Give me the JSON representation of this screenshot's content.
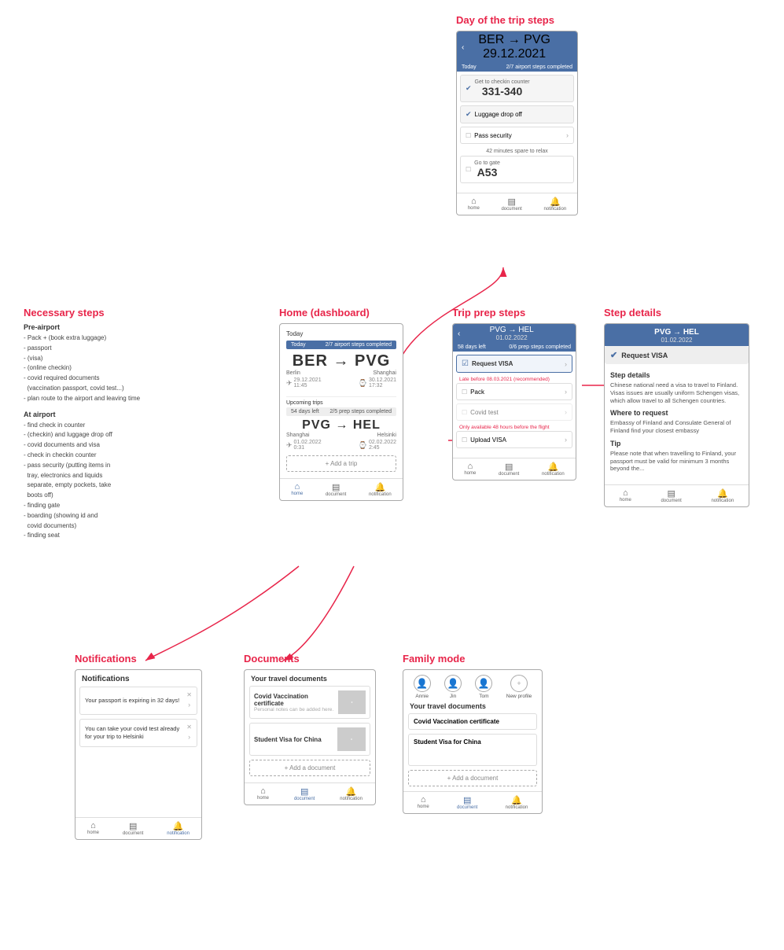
{
  "sections": {
    "day_of_trip": {
      "label": "Day of the trip steps",
      "header": {
        "route": "BER → PVG",
        "date": "29.12.2021"
      },
      "status_bar": {
        "label": "Today",
        "progress": "2/7 airport steps completed"
      },
      "steps": [
        {
          "id": 1,
          "text": "Get to checkin counter",
          "value": "331-340",
          "completed": true,
          "type": "big"
        },
        {
          "id": 2,
          "text": "Luggage drop off",
          "completed": true,
          "type": "normal"
        },
        {
          "id": 3,
          "text": "Pass security",
          "completed": false,
          "type": "normal",
          "has_chevron": true
        },
        {
          "id": 4,
          "relax": "42 minutes spare to relax"
        },
        {
          "id": 5,
          "text": "Go to gate",
          "value": "A53",
          "completed": false,
          "type": "big"
        }
      ],
      "bottom_nav": [
        "home",
        "document",
        "notification"
      ]
    },
    "home_dashboard": {
      "label": "Home (dashboard)",
      "today_label": "Today",
      "today_bar": {
        "left": "Today",
        "right": "2/7 airport steps completed"
      },
      "current_trip": {
        "route": "BER → PVG",
        "from_city": "Berlin",
        "to_city": "Shanghai",
        "from_date": "29.12.2021\n11:45",
        "to_date": "30.12.2021\n17:32"
      },
      "upcoming_label": "Upcoming trips",
      "upcoming_bar": {
        "left": "54 days left",
        "right": "2/5 prep steps completed"
      },
      "upcoming_trip": {
        "route": "PVG → HEL",
        "from_city": "Shanghai",
        "to_city": "Helsinki",
        "from_date": "01.02.2022\n0:31",
        "to_date": "02.02.2022\n2:45"
      },
      "add_trip": "+ Add a trip",
      "bottom_nav": [
        "home",
        "document",
        "notification"
      ]
    },
    "trip_prep": {
      "label": "Trip prep steps",
      "header": {
        "route": "PVG → HEL",
        "date": "01.02.2022"
      },
      "status_bar": {
        "left": "58 days left",
        "right": "0/6 prep steps completed"
      },
      "steps": [
        {
          "text": "Request VISA",
          "completed": false,
          "has_chevron": true,
          "highlighted": true
        },
        {
          "text": "Late before 08.03.2021 (recommended)",
          "type": "warning"
        },
        {
          "text": "Pack",
          "completed": false,
          "has_chevron": true
        },
        {
          "text": "Covid test",
          "completed": false,
          "has_chevron": true,
          "disabled": true
        },
        {
          "text": "Only available 48 hours before the flight",
          "type": "warning"
        },
        {
          "text": "Upload VISA",
          "completed": false,
          "has_chevron": true
        }
      ],
      "bottom_nav": [
        "home",
        "document",
        "notification"
      ]
    },
    "step_details": {
      "label": "Step details",
      "header": {
        "route": "PVG → HEL",
        "date": "01.02.2022"
      },
      "checked_step": "Request VISA",
      "sections": [
        {
          "title": "Step details",
          "text": "Chinese national need a visa to travel to Finland. Visas issues are usually uniform Schengen visas, which allow travel to all Schengen countries."
        },
        {
          "title": "Where to request",
          "text": "Embassy of Finland and Consulate General of Finland\nfind your closest embassy"
        },
        {
          "title": "Tip",
          "text": "Please note that when travelling to Finland, your passport must be valid for minimum 3 months beyond the..."
        }
      ],
      "bottom_nav": [
        "home",
        "document",
        "notification"
      ]
    },
    "notifications": {
      "label": "Notifications",
      "title": "Notifications",
      "items": [
        {
          "text": "Your passport is expiring in 32 days!",
          "has_chevron": true
        },
        {
          "text": "You can take your covid test already for your trip to Helsinki",
          "has_chevron": true
        }
      ],
      "bottom_nav": [
        "home",
        "document",
        "notification"
      ]
    },
    "documents": {
      "label": "Documents",
      "title": "Your travel documents",
      "items": [
        {
          "title": "Covid Vaccination certificate",
          "subtitle": "Personal notes can be added here."
        },
        {
          "title": "Student Visa for China",
          "subtitle": ""
        }
      ],
      "add_doc": "+ Add a document",
      "bottom_nav": [
        "home",
        "document",
        "notification"
      ]
    },
    "family_mode": {
      "label": "Family mode",
      "members": [
        {
          "name": "Annie",
          "active": false
        },
        {
          "name": "Jin",
          "active": false
        },
        {
          "name": "Tom",
          "active": false
        },
        {
          "name": "New profile",
          "active": false
        }
      ],
      "title": "Your travel documents",
      "items": [
        {
          "title": "Covid Vaccination certificate"
        },
        {
          "title": "Student Visa for China"
        }
      ],
      "add_doc": "+ Add a document",
      "bottom_nav": [
        "home",
        "document",
        "notification"
      ]
    },
    "necessary_steps": {
      "label": "Necessary steps",
      "pre_airport": {
        "title": "Pre-airport",
        "items": [
          "- Pack + (book extra luggage)",
          "- passport",
          "- (visa)",
          "- (online checkin)",
          "- covid required documents (vaccination passport, covid test...)",
          "- plan route to the airport and leaving time"
        ]
      },
      "at_airport": {
        "title": "At airport",
        "items": [
          "- find check in counter",
          "- (checkin) and luggage drop off",
          "- covid documents and visa",
          "- check in checkin counter",
          "- pass security (putting items in tray, electronics and liquids separate, empty pockets, take boots off)",
          "- finding gate",
          "- boarding (showing id and covid documents)",
          "- finding seat"
        ]
      }
    }
  }
}
